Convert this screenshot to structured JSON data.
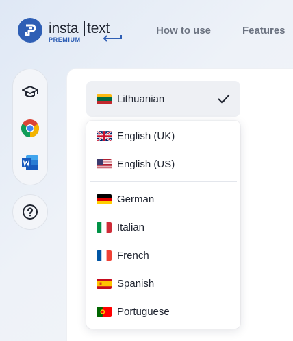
{
  "brand": {
    "name_part1": "insta",
    "name_part2": "text",
    "tier": "PREMIUM",
    "accent_color": "#2f5fb5"
  },
  "nav": {
    "links": [
      "How to use",
      "Features"
    ]
  },
  "rail": {
    "icons": [
      "graduation-cap-icon",
      "chrome-icon",
      "word-icon"
    ],
    "help_icon": "question-mark-icon"
  },
  "language_selector": {
    "selected": "Lithuanian",
    "selected_flag": "lt",
    "pinned": [
      {
        "label": "English (UK)",
        "flag": "gb"
      },
      {
        "label": "English (US)",
        "flag": "us"
      }
    ],
    "others": [
      {
        "label": "German",
        "flag": "de"
      },
      {
        "label": "Italian",
        "flag": "it"
      },
      {
        "label": "French",
        "flag": "fr"
      },
      {
        "label": "Spanish",
        "flag": "es"
      },
      {
        "label": "Portuguese",
        "flag": "pt"
      }
    ]
  }
}
